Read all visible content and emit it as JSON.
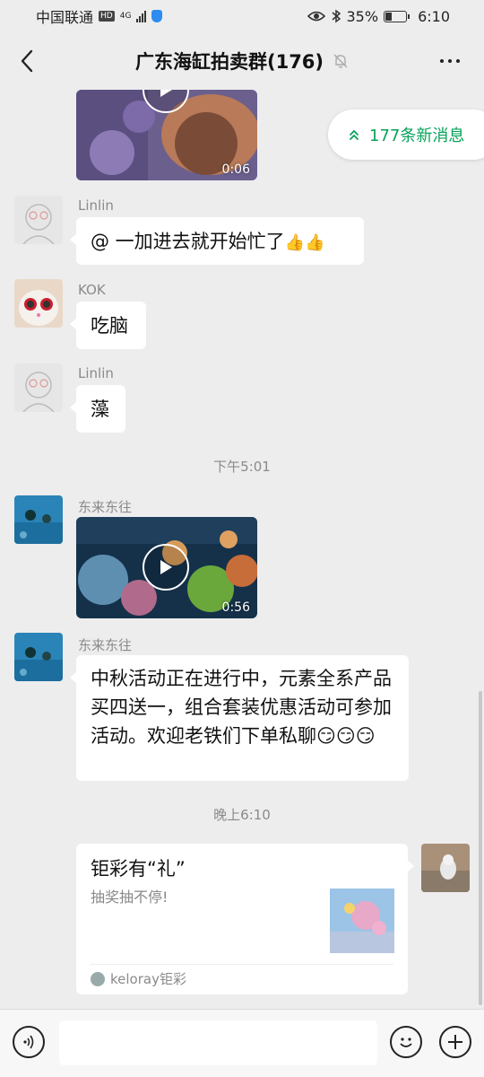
{
  "status_bar": {
    "carrier": "中国联通",
    "hd_badge": "HD",
    "network": "4G",
    "battery_percent": "35%",
    "battery_level": 0.35,
    "time": "6:10"
  },
  "nav": {
    "title": "广东海缸拍卖群(176)"
  },
  "new_messages_pill": {
    "label": "177条新消息"
  },
  "messages": [
    {
      "type": "video",
      "duration": "0:06"
    },
    {
      "type": "text",
      "sender": "Linlin",
      "text": "@ 一加进去就开始忙了",
      "emojis": "👍👍"
    },
    {
      "type": "text",
      "sender": "KOK",
      "text": "吃脑"
    },
    {
      "type": "text",
      "sender": "Linlin",
      "text": "藻"
    },
    {
      "type": "time",
      "text": "下午5:01"
    },
    {
      "type": "video",
      "sender": "东来东往",
      "duration": "0:56"
    },
    {
      "type": "text",
      "sender": "东来东往",
      "text": "中秋活动正在进行中，元素全系产品买四送一，组合套装优惠活动可参加活动。欢迎老铁们下单私聊"
    },
    {
      "type": "time",
      "text": "晚上6:10"
    },
    {
      "type": "card",
      "title": "钜彩有“礼”",
      "desc": "抽奖抽不停!",
      "source": "keloray钜彩"
    }
  ],
  "input": {
    "placeholder": ""
  }
}
